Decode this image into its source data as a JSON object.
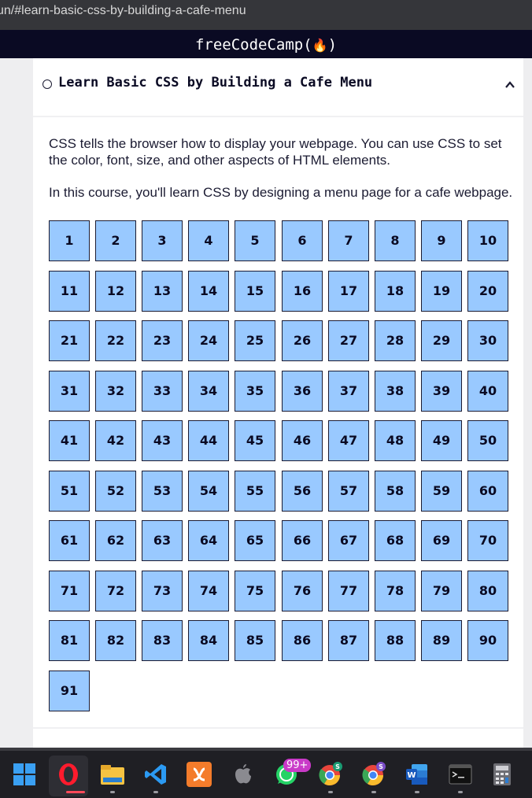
{
  "browser": {
    "url": "un/#learn-basic-css-by-building-a-cafe-menu"
  },
  "header": {
    "brand": "freeCodeCamp(",
    "brand_end": ")",
    "flame_icon": "fire-icon"
  },
  "course": {
    "title": "Learn Basic CSS by Building a Cafe Menu",
    "status_icon": "circle-icon",
    "toggle_icon": "chevron-up-icon",
    "description_1": "CSS tells the browser how to display your webpage. You can use CSS to set the color, font, size, and other aspects of HTML elements.",
    "description_2": "In this course, you'll learn CSS by designing a menu page for a cafe webpage.",
    "steps": [
      "1",
      "2",
      "3",
      "4",
      "5",
      "6",
      "7",
      "8",
      "9",
      "10",
      "11",
      "12",
      "13",
      "14",
      "15",
      "16",
      "17",
      "18",
      "19",
      "20",
      "21",
      "22",
      "23",
      "24",
      "25",
      "26",
      "27",
      "28",
      "29",
      "30",
      "31",
      "32",
      "33",
      "34",
      "35",
      "36",
      "37",
      "38",
      "39",
      "40",
      "41",
      "42",
      "43",
      "44",
      "45",
      "46",
      "47",
      "48",
      "49",
      "50",
      "51",
      "52",
      "53",
      "54",
      "55",
      "56",
      "57",
      "58",
      "59",
      "60",
      "61",
      "62",
      "63",
      "64",
      "65",
      "66",
      "67",
      "68",
      "69",
      "70",
      "71",
      "72",
      "73",
      "74",
      "75",
      "76",
      "77",
      "78",
      "79",
      "80",
      "81",
      "82",
      "83",
      "84",
      "85",
      "86",
      "87",
      "88",
      "89",
      "90",
      "91"
    ]
  },
  "taskbar": {
    "badge": "99+",
    "items": [
      "windows-start-icon",
      "opera-icon",
      "file-explorer-icon",
      "vscode-icon",
      "xampp-icon",
      "apple-icon",
      "whatsapp-icon",
      "chrome-profile-s-icon",
      "chrome-profile-s2-icon",
      "word-icon",
      "terminal-icon",
      "calculator-icon"
    ],
    "profile_s": "S",
    "profile_s2": "S",
    "word_letter": "W"
  },
  "colors": {
    "step_bg": "#99c9ff",
    "header_bg": "#0a0a23"
  }
}
